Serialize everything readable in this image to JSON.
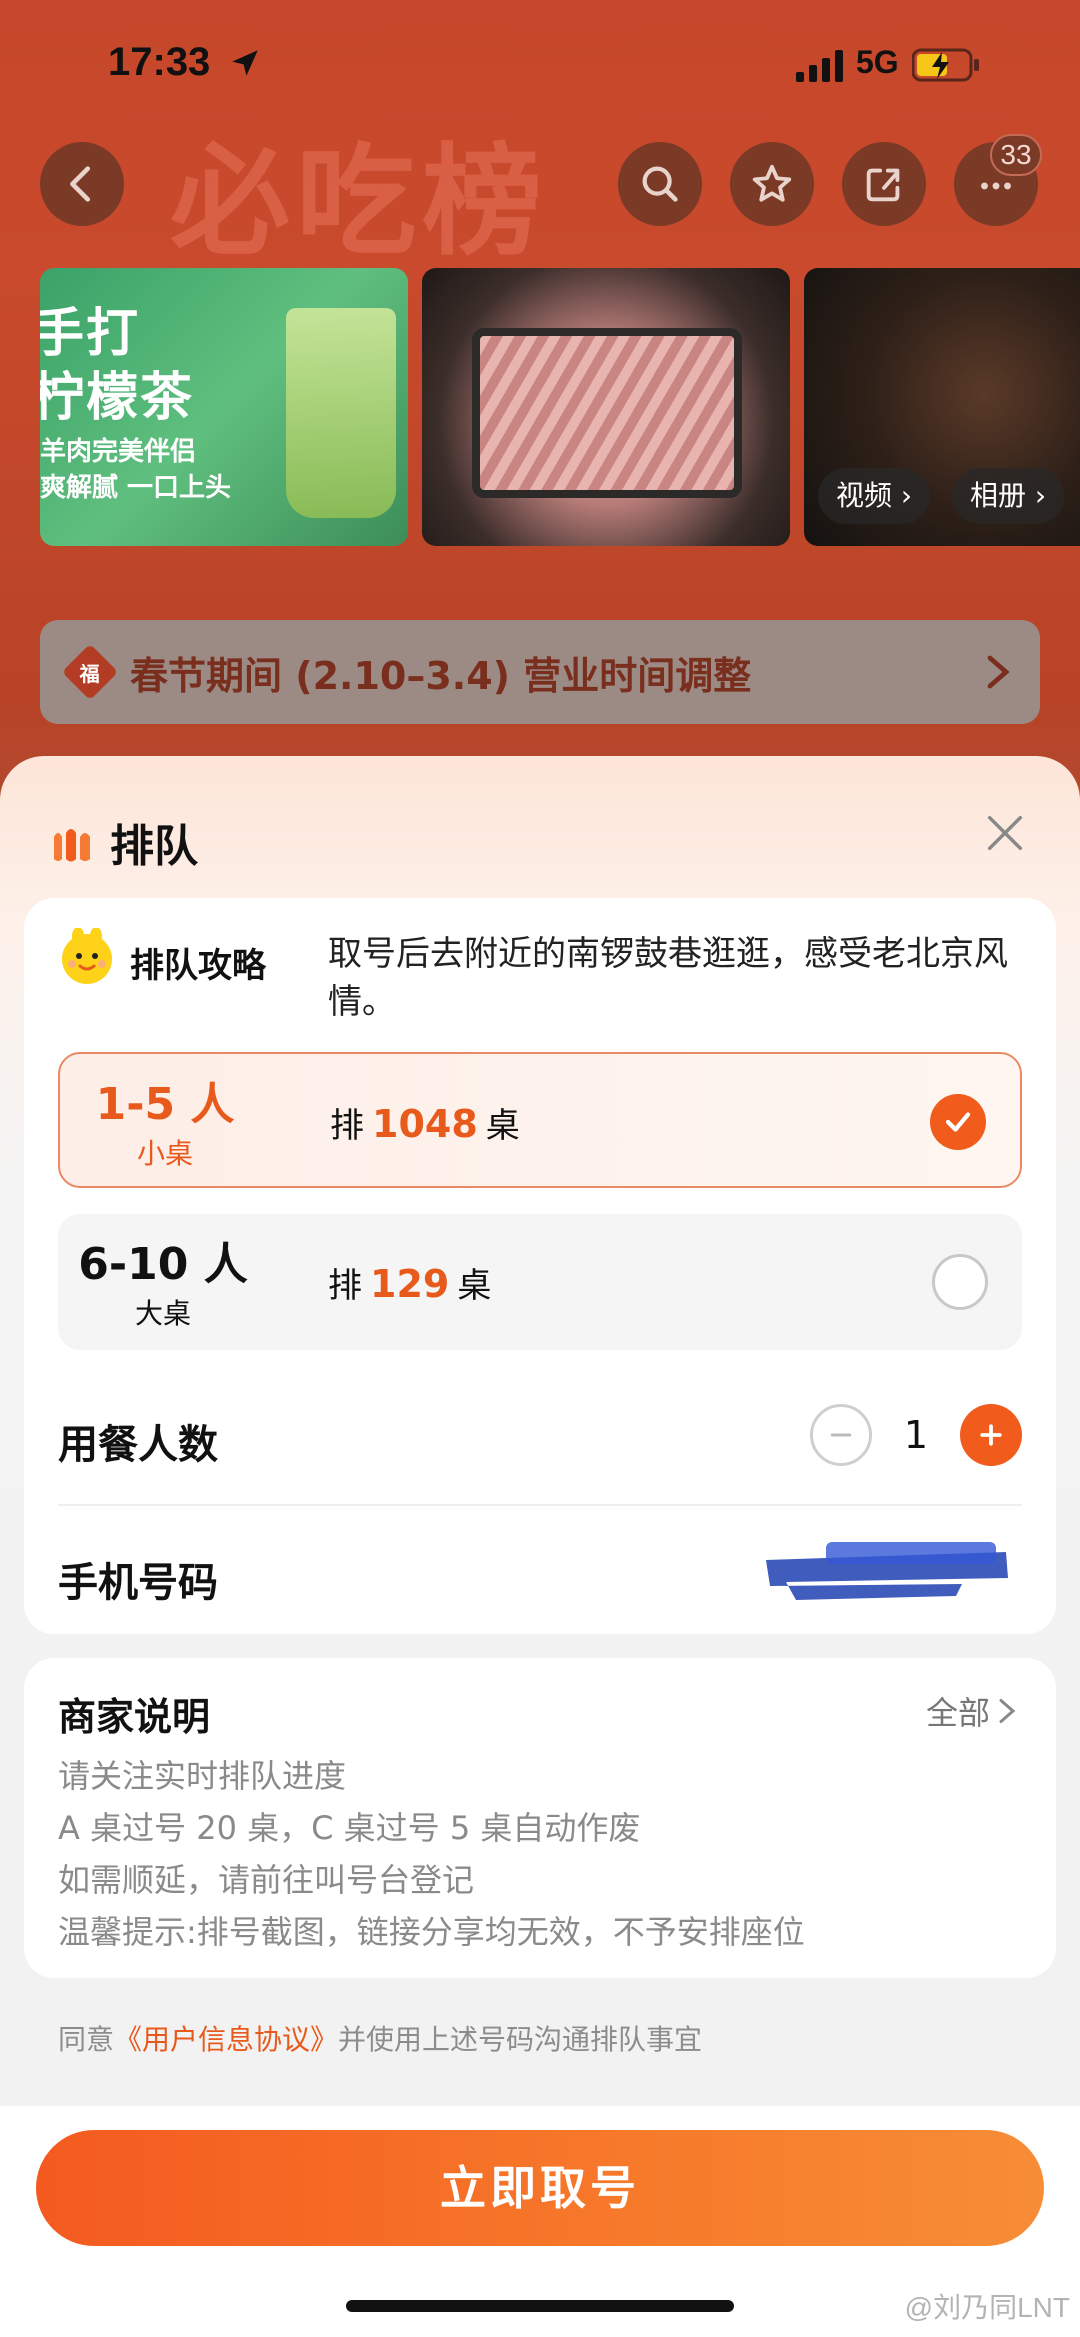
{
  "status_bar": {
    "time": "17:33",
    "network": "5G",
    "icons": [
      "location-arrow-icon",
      "signal-icon",
      "battery-charging-icon"
    ]
  },
  "nav": {
    "brand_watermark": "必吃榜",
    "badge_count": "33",
    "icons": [
      "back-icon",
      "search-icon",
      "star-icon",
      "share-icon",
      "more-icon"
    ]
  },
  "gallery": {
    "card1": {
      "title_lines": [
        "手打",
        "柠檬茶"
      ],
      "sub_lines": [
        "羊肉完美伴侣",
        "爽解腻 一口上头"
      ]
    },
    "tag_video": "视频",
    "tag_album": "相册"
  },
  "notice": {
    "icon_text": "福",
    "text": "春节期间 (2.10–3.4) 营业时间调整"
  },
  "sheet": {
    "title": "排队",
    "tip_label": "排队攻略",
    "tip_text": "取号后去附近的南锣鼓巷逛逛，感受老北京风情。",
    "options": [
      {
        "size": "1-5 人",
        "sub": "小桌",
        "prefix": "排",
        "count": "1048",
        "suffix": "桌",
        "selected": true
      },
      {
        "size": "6-10 人",
        "sub": "大桌",
        "prefix": "排",
        "count": "129",
        "suffix": "桌",
        "selected": false
      }
    ],
    "diners_label": "用餐人数",
    "diners_value": "1",
    "phone_label": "手机号码",
    "note_title": "商家说明",
    "note_all": "全部",
    "note_lines": [
      "请关注实时排队进度",
      "A 桌过号 20 桌，C 桌过号 5 桌自动作废",
      "如需顺延，请前往叫号台登记",
      "温馨提示:排号截图，链接分享均无效，不予安排座位"
    ],
    "agree_prefix": "同意",
    "agree_link": "《用户信息协议》",
    "agree_suffix": "并使用上述号码沟通排队事宜",
    "cta": "立即取号"
  },
  "watermark": "@刘乃同LNT",
  "colors": {
    "accent": "#f15b1c",
    "accent_text": "#e85a1c",
    "header_red": "#c6472b"
  }
}
